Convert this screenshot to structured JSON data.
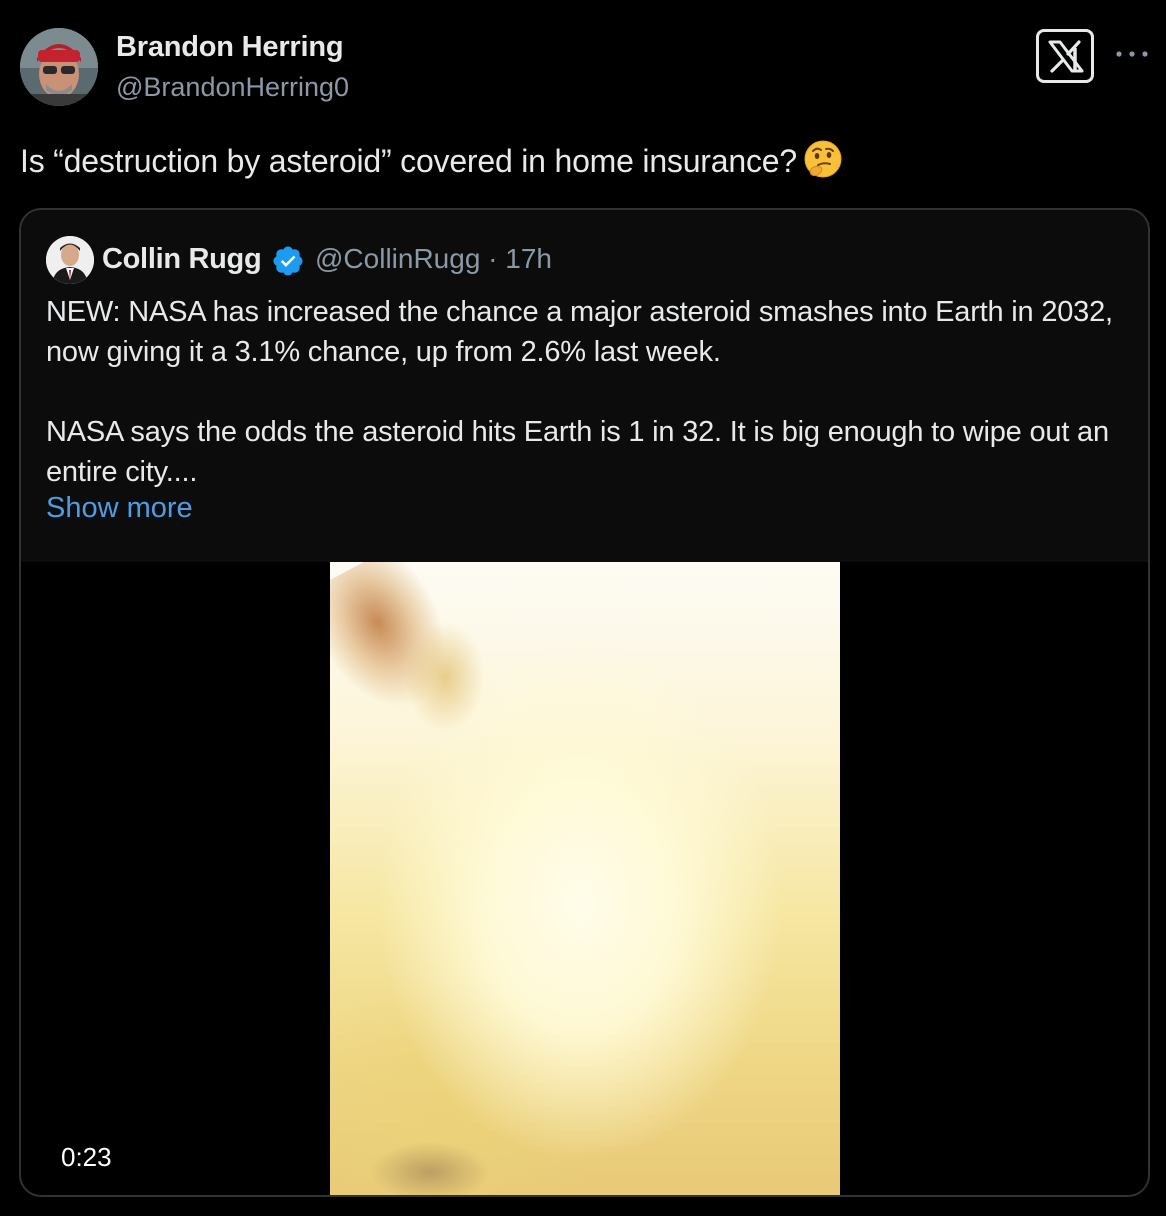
{
  "post": {
    "author_name": "Brandon Herring",
    "author_handle": "@BrandonHerring0",
    "text": "Is “destruction by asteroid” covered in home insurance?",
    "emoji": "thinking-face"
  },
  "header": {
    "logo_icon": "x-logo-icon",
    "more_icon": "more-icon"
  },
  "quote": {
    "author_name": "Collin Rugg",
    "verified": true,
    "handle_time": "@CollinRugg · 17h",
    "paragraph_1": "NEW: NASA has increased the chance a major asteroid smashes into Earth in 2032, now giving it a 3.1% chance, up from 2.6% last week.",
    "paragraph_2": "NASA says the odds the asteroid hits Earth is 1 in 32. It is big enough to wipe out an entire city....",
    "show_more": "Show more",
    "video": {
      "duration": "0:23"
    }
  },
  "colors": {
    "background": "#000000",
    "text_primary": "#e7e9ea",
    "text_secondary": "#8b98a5",
    "link": "#4e9de4",
    "verified": "#1d9bf0",
    "border": "#2f3336"
  }
}
